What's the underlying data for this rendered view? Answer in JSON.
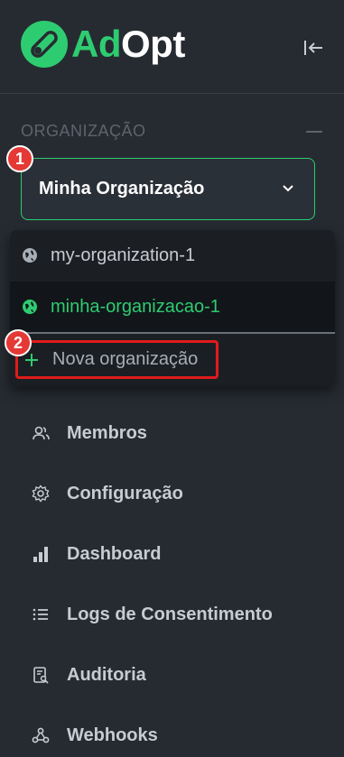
{
  "brand": {
    "name_part1": "Ad",
    "name_part2": "Opt",
    "accent": "#2ecc71"
  },
  "sidebar": {
    "section_title": "ORGANIZAÇÃO",
    "selected_org": "Minha Organização",
    "dropdown": {
      "options": [
        {
          "label": "my-organization-1",
          "active": false
        },
        {
          "label": "minha-organizacao-1",
          "active": true
        }
      ],
      "new_label": "Nova organização"
    },
    "nav": [
      {
        "label": "Membros",
        "icon": "users-icon"
      },
      {
        "label": "Configuração",
        "icon": "gear-icon"
      },
      {
        "label": "Dashboard",
        "icon": "bar-chart-icon"
      },
      {
        "label": "Logs de Consentimento",
        "icon": "list-icon"
      },
      {
        "label": "Auditoria",
        "icon": "audit-icon"
      },
      {
        "label": "Webhooks",
        "icon": "webhook-icon"
      }
    ]
  },
  "annotations": {
    "step1": "1",
    "step2": "2"
  }
}
